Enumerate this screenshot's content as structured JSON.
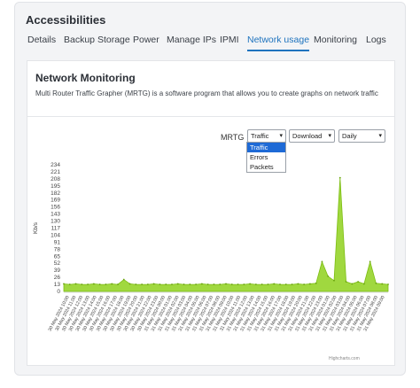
{
  "page": {
    "title": "Accessibilities",
    "tabs": [
      {
        "label": "Details"
      },
      {
        "label": "Backup Storage"
      },
      {
        "label": "Power"
      },
      {
        "label": "Manage IPs"
      },
      {
        "label": "IPMI"
      },
      {
        "label": "Network usage",
        "active": true
      },
      {
        "label": "Monitoring"
      },
      {
        "label": "Logs"
      }
    ]
  },
  "card": {
    "title": "Network Monitoring",
    "description": "Multi Router Traffic Grapher (MRTG) is a software program that allows you to create graphs on network traffic"
  },
  "controls": {
    "mrtg_label": "MRTG",
    "type_select": {
      "value": "Traffic",
      "options": [
        "Traffic",
        "Errors",
        "Packets"
      ]
    },
    "action_select": {
      "value": "Download"
    },
    "period_select": {
      "value": "Daily"
    }
  },
  "colors": {
    "accent": "#1e73be",
    "series": "#8fd11d",
    "selected_option": "#1e6ad6"
  },
  "credits": "Highcharts.com",
  "chart_data": {
    "type": "area",
    "ylabel": "Kb/s",
    "yticks": [
      0,
      13,
      26,
      39,
      52,
      65,
      78,
      91,
      104,
      117,
      130,
      143,
      156,
      169,
      182,
      195,
      208,
      221,
      234
    ],
    "ylim": [
      0,
      234
    ],
    "x": [
      "30 May 2024 10:00",
      "30 May 2024 11:00",
      "30 May 2024 12:00",
      "30 May 2024 13:00",
      "30 May 2024 14:00",
      "30 May 2024 15:00",
      "30 May 2024 16:00",
      "30 May 2024 17:00",
      "30 May 2024 18:00",
      "30 May 2024 19:00",
      "30 May 2024 20:00",
      "30 May 2024 21:00",
      "30 May 2024 22:00",
      "30 May 2024 23:00",
      "31 May 2024 00:00",
      "31 May 2024 01:00",
      "31 May 2024 02:00",
      "31 May 2024 03:00",
      "31 May 2024 04:00",
      "31 May 2024 05:00",
      "31 May 2024 06:00",
      "31 May 2024 07:00",
      "31 May 2024 08:00",
      "31 May 2024 09:00",
      "31 May 2024 10:00",
      "31 May 2024 11:00",
      "31 May 2024 12:00",
      "31 May 2024 13:00",
      "31 May 2024 14:00",
      "31 May 2024 15:00",
      "31 May 2024 16:00",
      "31 May 2024 17:00",
      "31 May 2024 18:00",
      "31 May 2024 19:00",
      "31 May 2024 20:00",
      "31 May 2024 21:00",
      "31 May 2024 22:00",
      "31 May 2024 23:00",
      "31 May 2024 01:00",
      "31 May 2024 02:00",
      "31 May 2024 03:00",
      "31 May 2024 04:00",
      "31 May 2024 05:00",
      "31 May 2024 06:00",
      "31 May 2024 07:00",
      "31 May 2024 08:00",
      "31 May 2024 09:00"
    ],
    "values": [
      14,
      13,
      14,
      13,
      13,
      14,
      13,
      13,
      14,
      13,
      22,
      14,
      13,
      13,
      13,
      14,
      13,
      13,
      13,
      14,
      13,
      13,
      13,
      14,
      13,
      13,
      13,
      14,
      13,
      13,
      13,
      14,
      13,
      13,
      13,
      14,
      13,
      13,
      13,
      14,
      13,
      14,
      15,
      55,
      28,
      20,
      210,
      18,
      14,
      18,
      14,
      55,
      15,
      14,
      13
    ]
  },
  "axis": {
    "ytick_labels": [
      "234",
      "221",
      "208",
      "195",
      "182",
      "169",
      "156",
      "143",
      "130",
      "117",
      "104",
      "91",
      "78",
      "65",
      "52",
      "39",
      "26",
      "13",
      "0"
    ]
  }
}
